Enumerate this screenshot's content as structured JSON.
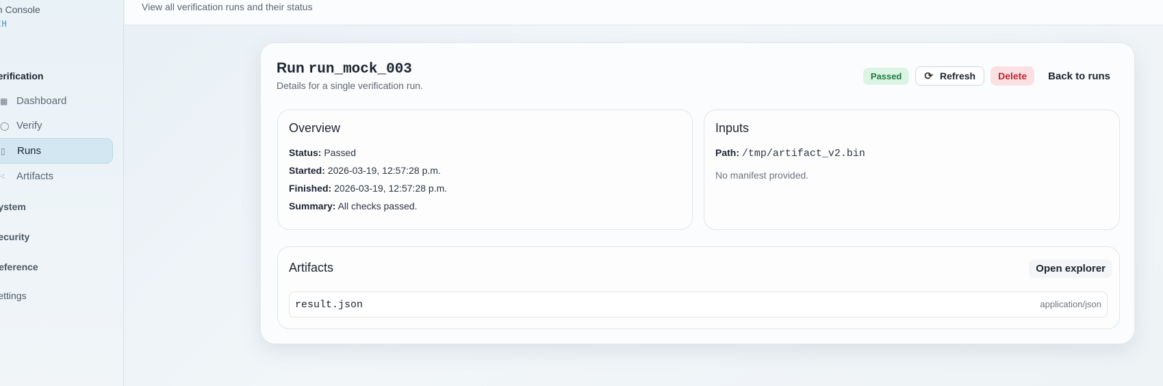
{
  "sidebar": {
    "brand_name": "on Console",
    "brand_sub": "ECH",
    "groups": [
      {
        "heading": "Verification",
        "items": [
          {
            "label": "Dashboard",
            "icon": "grid-icon"
          },
          {
            "label": "Verify",
            "icon": "circle-check-icon"
          },
          {
            "label": "Runs",
            "icon": "clipboard-icon",
            "active": true
          },
          {
            "label": "Artifacts",
            "icon": "nodes-icon"
          }
        ]
      },
      {
        "heading": "System"
      },
      {
        "heading": "Security"
      },
      {
        "heading": "Reference"
      },
      {
        "heading": "Settings"
      }
    ]
  },
  "topbar": {
    "subtitle": "View all verification runs and their status"
  },
  "run": {
    "title_prefix": "Run",
    "run_id": "run_mock_003",
    "description": "Details for a single verification run.",
    "status_badge": "Passed",
    "actions": {
      "refresh": "Refresh",
      "delete": "Delete",
      "back": "Back to runs"
    }
  },
  "overview": {
    "title": "Overview",
    "status_label": "Status:",
    "status_value": "Passed",
    "started_label": "Started:",
    "started_value": "2026-03-19, 12:57:28 p.m.",
    "finished_label": "Finished:",
    "finished_value": "2026-03-19, 12:57:28 p.m.",
    "summary_label": "Summary:",
    "summary_value": "All checks passed."
  },
  "inputs": {
    "title": "Inputs",
    "path_label": "Path:",
    "path_value": "/tmp/artifact_v2.bin",
    "manifest_note": "No manifest provided."
  },
  "artifacts": {
    "title": "Artifacts",
    "open_explorer": "Open explorer",
    "items": [
      {
        "name": "result.json",
        "type": "application/json"
      }
    ]
  },
  "colors": {
    "accent": "#3a8fc0",
    "passed_bg": "#dcf4e4",
    "passed_fg": "#1e7a3e",
    "delete_bg": "#fbe0e3",
    "delete_fg": "#c0232f",
    "active_nav_bg": "#d3e7f3"
  }
}
